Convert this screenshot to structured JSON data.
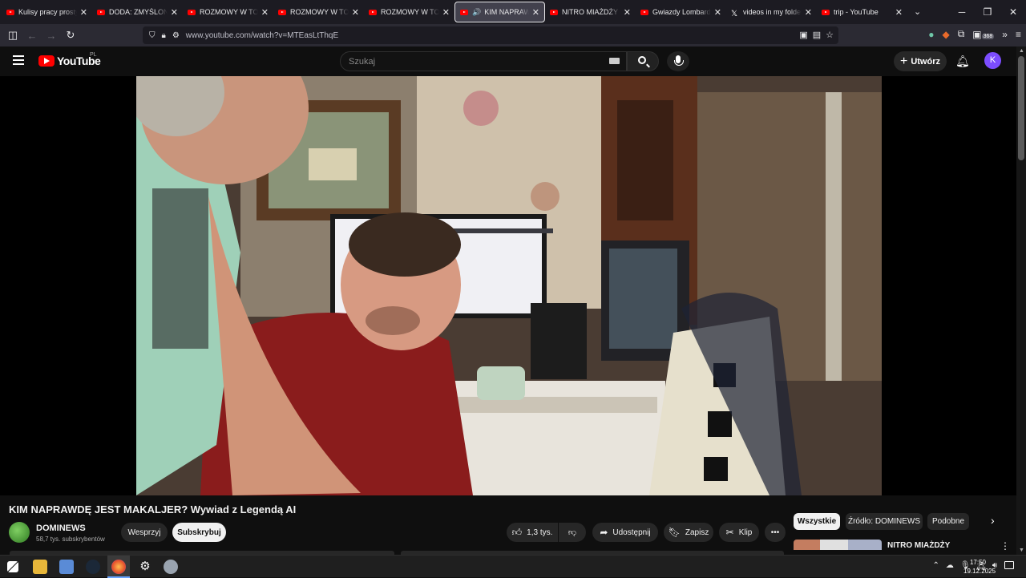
{
  "browser": {
    "tabs": [
      {
        "title": "Kulisy pracy prostytutki",
        "icon": "youtube-icon",
        "active": false
      },
      {
        "title": "DODA: ZMYŚLONE ŻY",
        "icon": "youtube-icon",
        "active": false
      },
      {
        "title": "ROZMOWY W TOKU",
        "icon": "youtube-icon",
        "active": false
      },
      {
        "title": "ROZMOWY W TOKU",
        "icon": "youtube-icon",
        "active": false
      },
      {
        "title": "ROZMOWY W TOKU",
        "icon": "youtube-icon",
        "active": false
      },
      {
        "title": "KIM NAPRAWDĘ",
        "icon": "youtube-icon",
        "active": true,
        "playing": true
      },
      {
        "title": "NITRO MIAŻDŻY MA",
        "icon": "youtube-icon",
        "active": false
      },
      {
        "title": "Gwiazdy Lombardu: N",
        "icon": "youtube-icon",
        "active": false
      },
      {
        "title": "videos in my folder",
        "icon": "x-icon",
        "active": false
      },
      {
        "title": "trip - YouTube",
        "icon": "youtube-icon",
        "active": false
      }
    ],
    "url": "www.youtube.com/watch?v=MTEasLtThqE",
    "extension_badge": "368"
  },
  "youtube": {
    "logo_text": "YouTube",
    "region": "PL",
    "search_placeholder": "Szukaj",
    "create_label": "Utwórz",
    "avatar_letter": "K",
    "accent_color": "#ff0000",
    "avatar_color": "#7c4dff"
  },
  "video": {
    "title": "KIM NAPRAWDĘ JEST MAKALJER? Wywiad z Legendą AI",
    "channel": "DOMINEWS",
    "subscribers": "58,7 tys. subskrybentów",
    "support_label": "Wesprzyj",
    "subscribe_label": "Subskrybuj",
    "likes": "1,3 tys.",
    "share_label": "Udostępnij",
    "save_label": "Zapisz",
    "clip_label": "Klip"
  },
  "chips": [
    "Wszystkie",
    "Źródło: DOMINEWS",
    "Podobne"
  ],
  "recommendation": {
    "title": "NITRO MIAŻDŻY MAMMONA!? DRAMA! BRUCE DEBATA Z"
  },
  "system": {
    "time": "17:50",
    "date": "19.12.2025"
  }
}
